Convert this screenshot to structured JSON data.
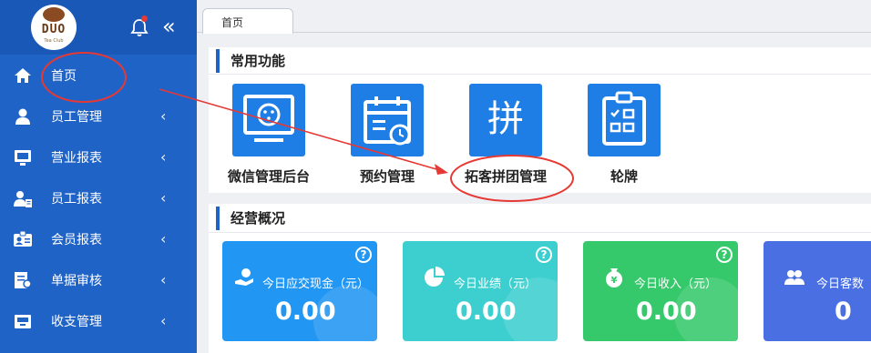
{
  "sidebar": {
    "logo_text": "DUO",
    "logo_sub": "Tea Club",
    "items": [
      {
        "label": "首页",
        "icon": "home-icon",
        "has_arrow": false
      },
      {
        "label": "员工管理",
        "icon": "user-icon",
        "has_arrow": true
      },
      {
        "label": "营业报表",
        "icon": "monitor-icon",
        "has_arrow": true
      },
      {
        "label": "员工报表",
        "icon": "user-report-icon",
        "has_arrow": true
      },
      {
        "label": "会员报表",
        "icon": "id-card-icon",
        "has_arrow": true
      },
      {
        "label": "单据审核",
        "icon": "audit-icon",
        "has_arrow": true
      },
      {
        "label": "收支管理",
        "icon": "inbox-icon",
        "has_arrow": true
      }
    ],
    "arrow": "‹",
    "collapse": "«"
  },
  "tabs": [
    {
      "label": "首页"
    }
  ],
  "common": {
    "title": "常用功能",
    "items": [
      {
        "label": "微信管理后台",
        "icon": "wechat-admin-icon"
      },
      {
        "label": "预约管理",
        "icon": "calendar-icon"
      },
      {
        "label": "拓客拼团管理",
        "icon": "group-buy-icon",
        "glyph": "拼"
      },
      {
        "label": "轮牌",
        "icon": "clipboard-grid-icon"
      }
    ]
  },
  "overview": {
    "title": "经营概况",
    "cards": [
      {
        "title": "今日应交现金（元）",
        "value": "0.00",
        "color": "#2196f3",
        "icon": "cash-hand-icon"
      },
      {
        "title": "今日业绩（元）",
        "value": "0.00",
        "color": "#3dcfcf",
        "icon": "pie-chart-icon"
      },
      {
        "title": "今日收入（元）",
        "value": "0.00",
        "color": "#36c96b",
        "icon": "money-bag-icon"
      },
      {
        "title": "今日客数",
        "value": "0",
        "color": "#4a6fe3",
        "icon": "users-icon"
      }
    ],
    "help": "?"
  },
  "colors": {
    "sidebar": "#1f63c7",
    "accent": "#1e7ee5",
    "annotation": "#e53935"
  }
}
